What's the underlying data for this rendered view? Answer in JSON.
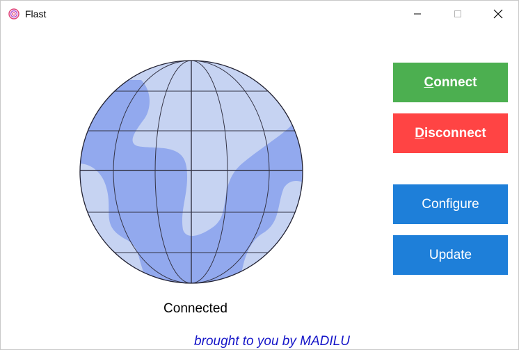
{
  "window": {
    "title": "Flast",
    "controls": {
      "minimize_icon": "minimize-icon",
      "maximize_icon": "maximize-icon",
      "close_icon": "close-icon"
    }
  },
  "status": {
    "text": "Connected"
  },
  "buttons": {
    "connect": {
      "mnemonic": "C",
      "rest": "onnect",
      "color": "#4caf50"
    },
    "disconnect": {
      "mnemonic": "D",
      "rest": "isconnect",
      "color": "#ff4444"
    },
    "configure": {
      "label": "Configure",
      "color": "#1e7fd9"
    },
    "update": {
      "label": "Update",
      "color": "#1e7fd9"
    }
  },
  "footer": {
    "credit": "brought to you by MADILU",
    "color": "#1515c8"
  },
  "icons": {
    "app": "spiral-app-icon",
    "globe": "globe-icon"
  }
}
